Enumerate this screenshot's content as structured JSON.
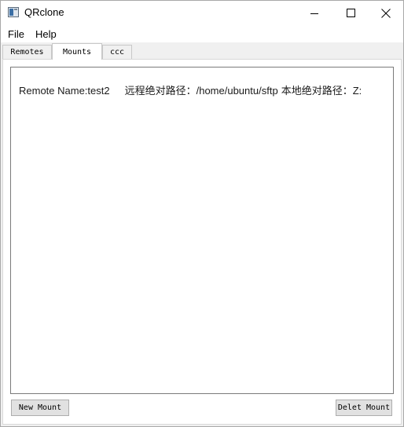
{
  "window": {
    "title": "QRclone"
  },
  "menu": {
    "file": "File",
    "help": "Help"
  },
  "tabs": [
    {
      "label": "Remotes",
      "active": false
    },
    {
      "label": "Mounts",
      "active": true
    },
    {
      "label": "ccc",
      "active": false
    }
  ],
  "mounts": [
    {
      "remote_name": "Remote Name:test2",
      "remote_path": "远程绝对路径：/home/ubuntu/sftp",
      "local_path": "本地绝对路径：Z:"
    }
  ],
  "buttons": {
    "new_mount": "New Mount",
    "delete_mount": "Delet Mount"
  },
  "icons": {
    "app": "app-icon",
    "minimize": "minimize-icon",
    "maximize": "maximize-icon",
    "close": "close-icon"
  }
}
